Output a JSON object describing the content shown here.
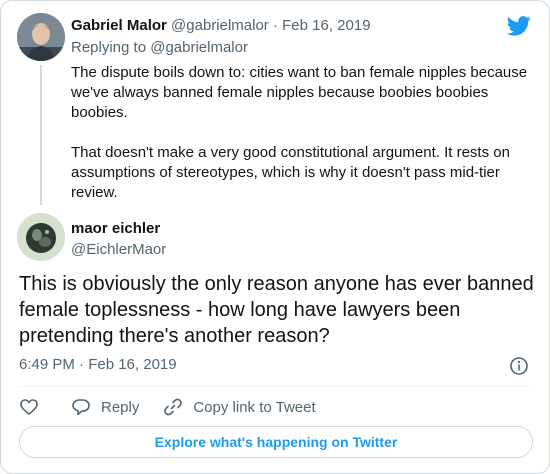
{
  "colors": {
    "brand_blue": "#1d9bf0",
    "text_primary": "#0f1419",
    "text_secondary": "#536471",
    "border": "#cfd9de"
  },
  "icons": {
    "brand": "twitter-bird-icon",
    "info": "info-icon",
    "like": "heart-icon",
    "reply": "speech-bubble-icon",
    "copy": "link-icon"
  },
  "parent_tweet": {
    "display_name": "Gabriel Malor",
    "handle": "@gabrielmalor",
    "separator": "·",
    "date": "Feb 16, 2019",
    "replying_to": "Replying to @gabrielmalor",
    "paragraphs": [
      "The dispute boils down to: cities want to ban female nipples because we've always banned female nipples because boobies boobies boobies.",
      "That doesn't make a very good constitutional argument. It rests on assumptions of stereotypes, which is why it doesn't pass mid-tier review."
    ]
  },
  "main_tweet": {
    "display_name": "maor eichler",
    "handle": "@EichlerMaor",
    "text": "This is obviously the only reason anyone has ever banned female toplessness - how long have lawyers been pretending there's another reason?",
    "timestamp": "6:49 PM · Feb 16, 2019"
  },
  "actions": {
    "reply_label": "Reply",
    "copy_label": "Copy link to Tweet"
  },
  "explore_label": "Explore what's happening on Twitter"
}
